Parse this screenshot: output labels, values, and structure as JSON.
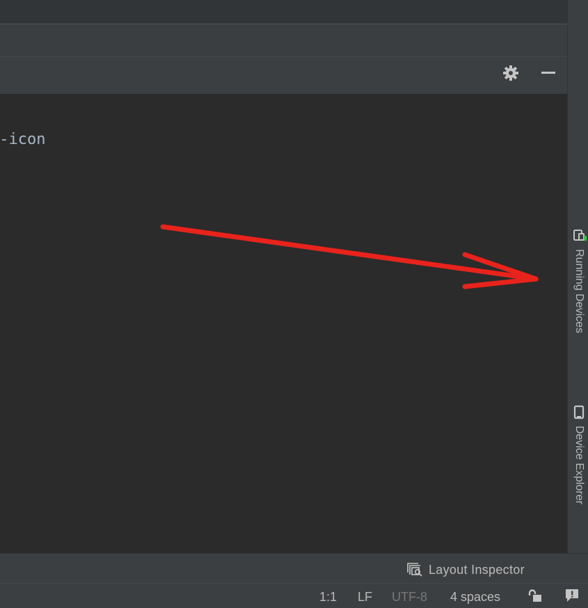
{
  "editor": {
    "visible_code_fragment": "v-icon"
  },
  "tool_window_header": {
    "settings_icon": "gear-icon",
    "hide_icon": "minimize-icon"
  },
  "right_sidebar": {
    "tabs": [
      {
        "label": "Running Devices",
        "icon": "running-devices-icon"
      },
      {
        "label": "Device Explorer",
        "icon": "device-explorer-icon"
      }
    ]
  },
  "bottom_tools": {
    "layout_inspector_label": "Layout Inspector",
    "layout_inspector_icon": "layout-inspector-icon"
  },
  "status_bar": {
    "position": "1:1",
    "line_ending": "LF",
    "encoding": "UTF-8",
    "indent": "4 spaces",
    "lock_icon": "lock-icon",
    "notifications_icon": "notifications-icon"
  },
  "colors": {
    "editor_bg": "#2b2b2b",
    "panel_bg": "#3c3f41",
    "text": "#bbbbbb",
    "code_text": "#a9b7c6",
    "annotation_arrow": "#e8231c",
    "running_indicator": "#3fbf4a"
  }
}
